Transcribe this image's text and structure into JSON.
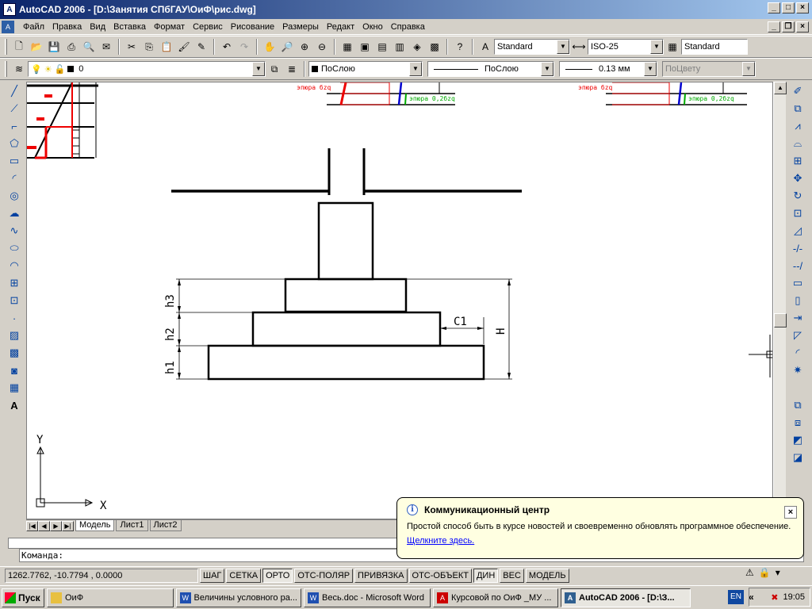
{
  "window": {
    "title": "AutoCAD 2006 - [D:\\Занятия СПбГАУ\\ОиФ\\рис.dwg]",
    "min": "_",
    "max": "□",
    "close": "×",
    "restore": "❐"
  },
  "menu": [
    "Файл",
    "Правка",
    "Вид",
    "Вставка",
    "Формат",
    "Сервис",
    "Рисование",
    "Размеры",
    "Редакт",
    "Окно",
    "Справка"
  ],
  "toolbar": {
    "text_style": "Standard",
    "dim_style": "ISO-25",
    "table_style": "Standard"
  },
  "properties": {
    "layer": "0",
    "color": "ПоСлою",
    "linetype": "ПоСлою",
    "lineweight": "0.13 мм",
    "plotstyle": "ПоЦвету"
  },
  "drawing": {
    "dim_labels": [
      "h3",
      "h2",
      "h1",
      "H",
      "C1"
    ],
    "epure_labels": {
      "left_red": "эпюра бzq",
      "left_green": "эпюра 0,2бzq",
      "right_red": "эпюра бzq",
      "right_green": "эпюра 0,2бzq"
    },
    "ucs_x": "X",
    "ucs_y": "Y"
  },
  "layout_tabs": [
    "Модель",
    "Лист1",
    "Лист2"
  ],
  "command": {
    "prompt": "Команда:"
  },
  "status": {
    "coords": "1262.7762, -10.7794 , 0.0000",
    "buttons": [
      {
        "label": "ШАГ",
        "on": false
      },
      {
        "label": "СЕТКА",
        "on": false
      },
      {
        "label": "ОРТО",
        "on": true
      },
      {
        "label": "ОТС-ПОЛЯР",
        "on": false
      },
      {
        "label": "ПРИВЯЗКА",
        "on": false
      },
      {
        "label": "ОТС-ОБЪЕКТ",
        "on": false
      },
      {
        "label": "ДИН",
        "on": true
      },
      {
        "label": "ВЕС",
        "on": false
      },
      {
        "label": "МОДЕЛЬ",
        "on": false
      }
    ]
  },
  "balloon": {
    "title": "Коммуникационный центр",
    "text": "Простой способ быть в курсе новостей и своевременно обновлять программное обеспечение.",
    "link": "Щелкните здесь."
  },
  "taskbar": {
    "start": "Пуск",
    "tasks": [
      {
        "label": "ОиФ",
        "icon": "folder-icon",
        "active": false
      },
      {
        "label": "Величины условного ра...",
        "icon": "word-icon",
        "active": false
      },
      {
        "label": "Весь.doc - Microsoft Word",
        "icon": "word-icon",
        "active": false
      },
      {
        "label": "Курсовой по ОиФ _МУ ...",
        "icon": "pdf-icon",
        "active": false
      },
      {
        "label": "AutoCAD 2006 - [D:\\З...",
        "icon": "autocad-icon",
        "active": true
      }
    ],
    "lang": "EN",
    "time": "19:05"
  }
}
